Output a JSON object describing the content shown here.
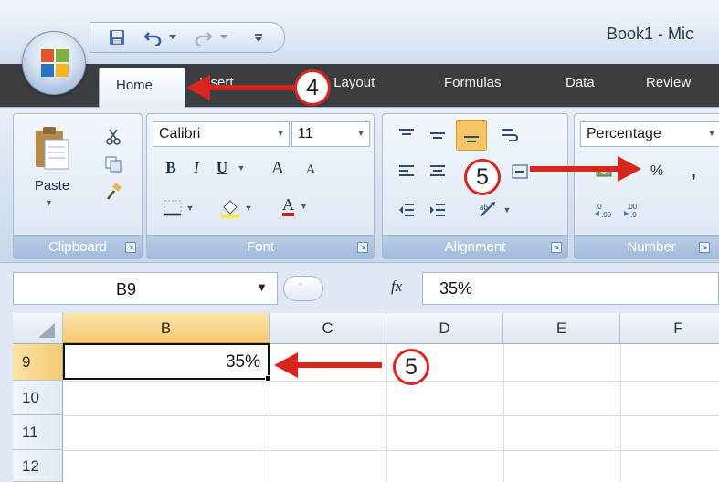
{
  "titlebar": {
    "doc_title": "Book1 - Mic"
  },
  "tabs": {
    "home": "Home",
    "insert": "Insert",
    "page_layout": "Page Layout",
    "formulas": "Formulas",
    "data": "Data",
    "review": "Review"
  },
  "ribbon": {
    "clipboard": {
      "label": "Clipboard",
      "paste_label": "Paste"
    },
    "font": {
      "label": "Font",
      "family": "Calibri",
      "size": "11",
      "bold": "B",
      "italic": "I",
      "underline": "U",
      "grow": "A",
      "shrink": "A",
      "color": "A"
    },
    "alignment": {
      "label": "Alignment"
    },
    "number": {
      "label": "Number",
      "format": "Percentage",
      "percent": "%",
      "comma": ","
    }
  },
  "formula_bar": {
    "name_box": "B9",
    "fx": "fx",
    "value": "35%"
  },
  "grid": {
    "columns": [
      "B",
      "C",
      "D",
      "E",
      "F"
    ],
    "rows": [
      "9",
      "10",
      "11",
      "12"
    ],
    "cell_b9": "35%"
  },
  "callouts": {
    "step4": "4",
    "step5_number": "5",
    "step5_cell": "5"
  },
  "colors": {
    "annotation_red": "#d9261c",
    "tab_strip": "#3c3d40",
    "selection_orange": "#f6c971",
    "highlight_button": "#f7c564"
  }
}
